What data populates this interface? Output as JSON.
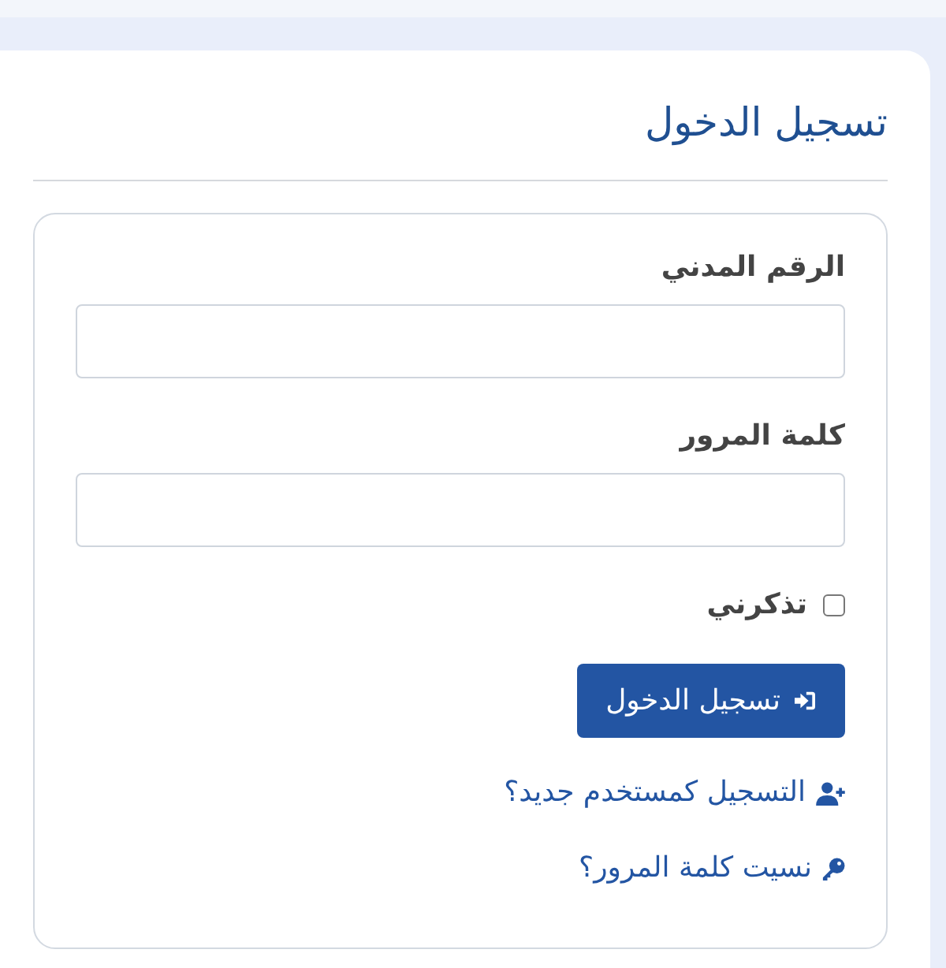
{
  "header": {
    "title": "تسجيل الدخول"
  },
  "form": {
    "fields": [
      {
        "label": "الرقم المدني"
      },
      {
        "label": "كلمة المرور"
      }
    ],
    "remember": {
      "label": "تذكرني",
      "checked": false
    },
    "submit": {
      "label": "تسجيل الدخول"
    },
    "links": [
      {
        "kind": "register",
        "label": "التسجيل كمستخدم جديد؟"
      },
      {
        "kind": "recover",
        "label": "نسيت كلمة المرور؟"
      }
    ]
  }
}
